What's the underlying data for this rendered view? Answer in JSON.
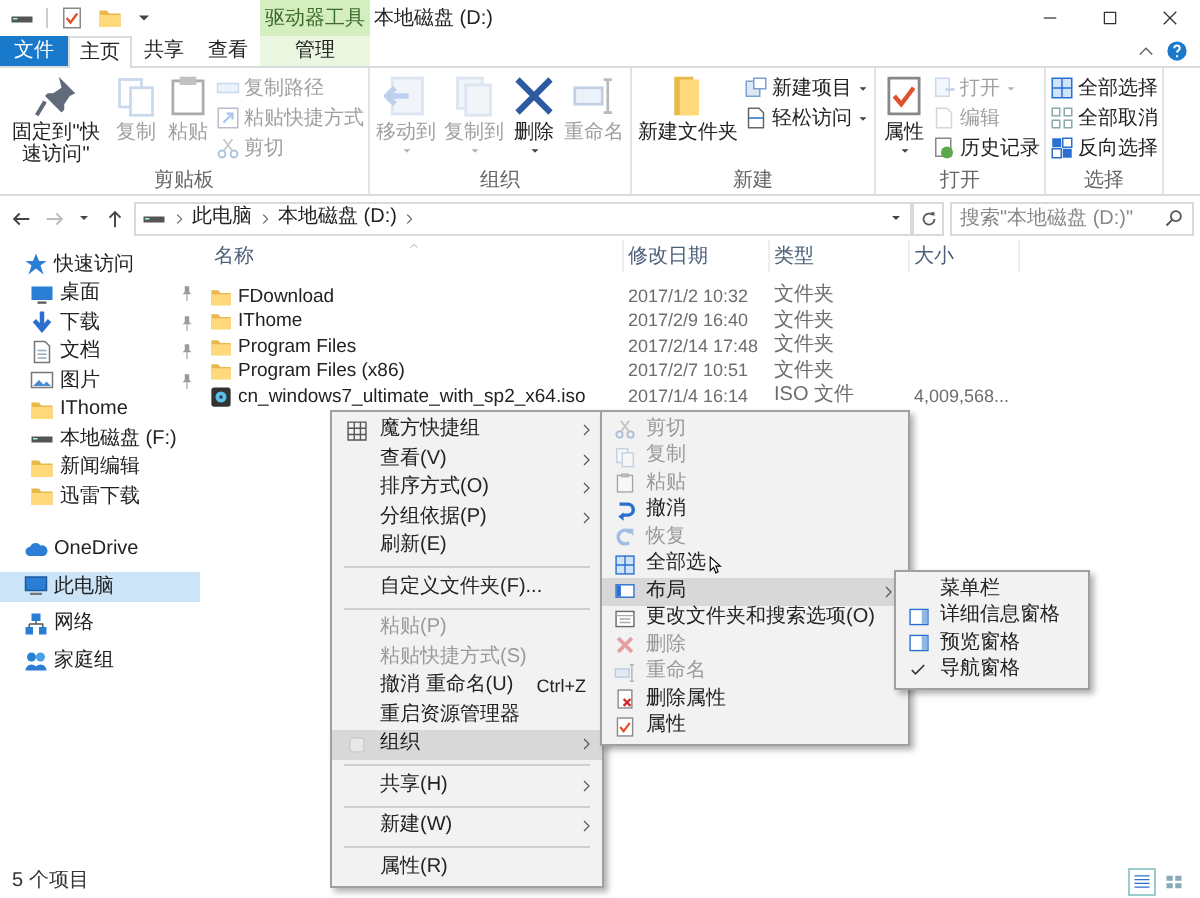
{
  "window": {
    "title": "本地磁盘 (D:)",
    "context_label": "驱动器工具"
  },
  "tabs": [
    {
      "label": "文件",
      "kind": "file",
      "selected": false
    },
    {
      "label": "主页",
      "kind": "normal",
      "selected": true
    },
    {
      "label": "共享",
      "kind": "normal",
      "selected": false
    },
    {
      "label": "查看",
      "kind": "normal",
      "selected": false
    },
    {
      "label": "管理",
      "kind": "context",
      "selected": false
    }
  ],
  "ribbon_groups": [
    {
      "label": "剪贴板",
      "buttons": [
        {
          "label": "固定到\"快速访问\"",
          "kind": "large",
          "disabled": false,
          "dropdown": false
        },
        {
          "label": "复制",
          "kind": "large",
          "disabled": true,
          "dropdown": false
        },
        {
          "label": "粘贴",
          "kind": "large",
          "disabled": true,
          "dropdown": false
        },
        {
          "label": "复制路径",
          "kind": "small",
          "disabled": true,
          "dropdown": false
        },
        {
          "label": "粘贴快捷方式",
          "kind": "small",
          "disabled": true,
          "dropdown": false
        },
        {
          "label": "剪切",
          "kind": "small",
          "disabled": true,
          "dropdown": false
        }
      ]
    },
    {
      "label": "组织",
      "buttons": [
        {
          "label": "移动到",
          "kind": "large",
          "disabled": true,
          "dropdown": true
        },
        {
          "label": "复制到",
          "kind": "large",
          "disabled": true,
          "dropdown": true
        },
        {
          "label": "删除",
          "kind": "large",
          "disabled": false,
          "dropdown": true
        },
        {
          "label": "重命名",
          "kind": "large",
          "disabled": true,
          "dropdown": false
        }
      ]
    },
    {
      "label": "新建",
      "buttons": [
        {
          "label": "新建文件夹",
          "kind": "large",
          "disabled": false,
          "dropdown": false
        },
        {
          "label": "新建项目",
          "kind": "small",
          "disabled": false,
          "dropdown": true
        },
        {
          "label": "轻松访问",
          "kind": "small",
          "disabled": false,
          "dropdown": true
        }
      ]
    },
    {
      "label": "打开",
      "buttons": [
        {
          "label": "属性",
          "kind": "large",
          "disabled": false,
          "dropdown": true
        },
        {
          "label": "打开",
          "kind": "small",
          "disabled": true,
          "dropdown": true
        },
        {
          "label": "编辑",
          "kind": "small",
          "disabled": true,
          "dropdown": false
        },
        {
          "label": "历史记录",
          "kind": "small",
          "disabled": false,
          "dropdown": false
        }
      ]
    },
    {
      "label": "选择",
      "buttons": [
        {
          "label": "全部选择",
          "kind": "small",
          "disabled": false,
          "dropdown": false
        },
        {
          "label": "全部取消",
          "kind": "small",
          "disabled": false,
          "dropdown": false
        },
        {
          "label": "反向选择",
          "kind": "small",
          "disabled": false,
          "dropdown": false
        }
      ]
    }
  ],
  "address": {
    "path": [
      "此电脑",
      "本地磁盘 (D:)"
    ]
  },
  "search": {
    "placeholder": "搜索\"本地磁盘 (D:)\""
  },
  "navigation": [
    {
      "label": "快速访问",
      "selected": false,
      "pinned": false,
      "children": [
        {
          "label": "桌面",
          "selected": false,
          "pinned": true
        },
        {
          "label": "下载",
          "selected": false,
          "pinned": true
        },
        {
          "label": "文档",
          "selected": false,
          "pinned": true
        },
        {
          "label": "图片",
          "selected": false,
          "pinned": true
        },
        {
          "label": "IThome",
          "selected": false,
          "pinned": false
        },
        {
          "label": "本地磁盘 (F:)",
          "selected": false,
          "pinned": false
        },
        {
          "label": "新闻编辑",
          "selected": false,
          "pinned": false
        },
        {
          "label": "迅雷下载",
          "selected": false,
          "pinned": false
        }
      ]
    },
    {
      "label": "OneDrive",
      "selected": false,
      "pinned": false
    },
    {
      "label": "此电脑",
      "selected": true,
      "pinned": false
    },
    {
      "label": "网络",
      "selected": false,
      "pinned": false
    },
    {
      "label": "家庭组",
      "selected": false,
      "pinned": false
    }
  ],
  "file_list": {
    "columns": [
      "名称",
      "修改日期",
      "类型",
      "大小"
    ],
    "rows": [
      {
        "kind": "folder",
        "name": "FDownload",
        "date": "2017/1/2 10:32",
        "type": "文件夹"
      },
      {
        "kind": "folder",
        "name": "IThome",
        "date": "2017/2/9 16:40",
        "type": "文件夹"
      },
      {
        "kind": "folder",
        "name": "Program Files",
        "date": "2017/2/14 17:48",
        "type": "文件夹"
      },
      {
        "kind": "folder",
        "name": "Program Files (x86)",
        "date": "2017/2/7 10:51",
        "type": "文件夹"
      },
      {
        "kind": "iso",
        "name": "cn_windows7_ultimate_with_sp2_x64.iso",
        "date": "2017/1/4 16:14",
        "type": "ISO 文件",
        "size": "4,009,568..."
      }
    ]
  },
  "context_menu": [
    {
      "kind": "item",
      "label": "魔方快捷组",
      "submenu": true,
      "disabled": false,
      "selected": false
    },
    {
      "kind": "item",
      "label": "查看(V)",
      "submenu": true,
      "disabled": false,
      "selected": false
    },
    {
      "kind": "item",
      "label": "排序方式(O)",
      "submenu": true,
      "disabled": false,
      "selected": false
    },
    {
      "kind": "item",
      "label": "分组依据(P)",
      "submenu": true,
      "disabled": false,
      "selected": false
    },
    {
      "kind": "item",
      "label": "刷新(E)",
      "submenu": false,
      "disabled": false,
      "selected": false
    },
    {
      "kind": "separator"
    },
    {
      "kind": "item",
      "label": "自定义文件夹(F)...",
      "submenu": false,
      "disabled": false,
      "selected": false
    },
    {
      "kind": "separator"
    },
    {
      "kind": "item",
      "label": "粘贴(P)",
      "submenu": false,
      "disabled": true,
      "selected": false
    },
    {
      "kind": "item",
      "label": "粘贴快捷方式(S)",
      "submenu": false,
      "disabled": true,
      "selected": false
    },
    {
      "kind": "item",
      "label": "撤消 重命名(U)",
      "shortcut": "Ctrl+Z",
      "submenu": false,
      "disabled": false,
      "selected": false
    },
    {
      "kind": "item",
      "label": "重启资源管理器",
      "submenu": false,
      "disabled": false,
      "selected": false
    },
    {
      "kind": "item",
      "label": "组织",
      "submenu": true,
      "disabled": false,
      "selected": true
    },
    {
      "kind": "separator"
    },
    {
      "kind": "item",
      "label": "共享(H)",
      "submenu": true,
      "disabled": false,
      "selected": false
    },
    {
      "kind": "separator"
    },
    {
      "kind": "item",
      "label": "新建(W)",
      "submenu": true,
      "disabled": false,
      "selected": false
    },
    {
      "kind": "separator"
    },
    {
      "kind": "item",
      "label": "属性(R)",
      "submenu": false,
      "disabled": false,
      "selected": false
    }
  ],
  "organize_menu": [
    {
      "label": "剪切",
      "submenu": false,
      "disabled": true,
      "selected": false
    },
    {
      "label": "复制",
      "submenu": false,
      "disabled": true,
      "selected": false
    },
    {
      "label": "粘贴",
      "submenu": false,
      "disabled": true,
      "selected": false
    },
    {
      "label": "撤消",
      "submenu": false,
      "disabled": false,
      "selected": false
    },
    {
      "label": "恢复",
      "submenu": false,
      "disabled": true,
      "selected": false
    },
    {
      "label": "全部选",
      "submenu": false,
      "disabled": false,
      "selected": false
    },
    {
      "label": "布局",
      "submenu": true,
      "disabled": false,
      "selected": true
    },
    {
      "label": "更改文件夹和搜索选项(O)",
      "submenu": false,
      "disabled": false,
      "selected": false
    },
    {
      "label": "删除",
      "submenu": false,
      "disabled": true,
      "selected": false
    },
    {
      "label": "重命名",
      "submenu": false,
      "disabled": true,
      "selected": false
    },
    {
      "label": "删除属性",
      "submenu": false,
      "disabled": false,
      "selected": false
    },
    {
      "label": "属性",
      "submenu": false,
      "disabled": false,
      "selected": false
    }
  ],
  "layout_menu": [
    {
      "label": "菜单栏",
      "checked": false
    },
    {
      "label": "详细信息窗格",
      "checked": false
    },
    {
      "label": "预览窗格",
      "checked": false
    },
    {
      "label": "导航窗格",
      "checked": true
    }
  ],
  "status_bar": {
    "text": "5 个项目"
  }
}
